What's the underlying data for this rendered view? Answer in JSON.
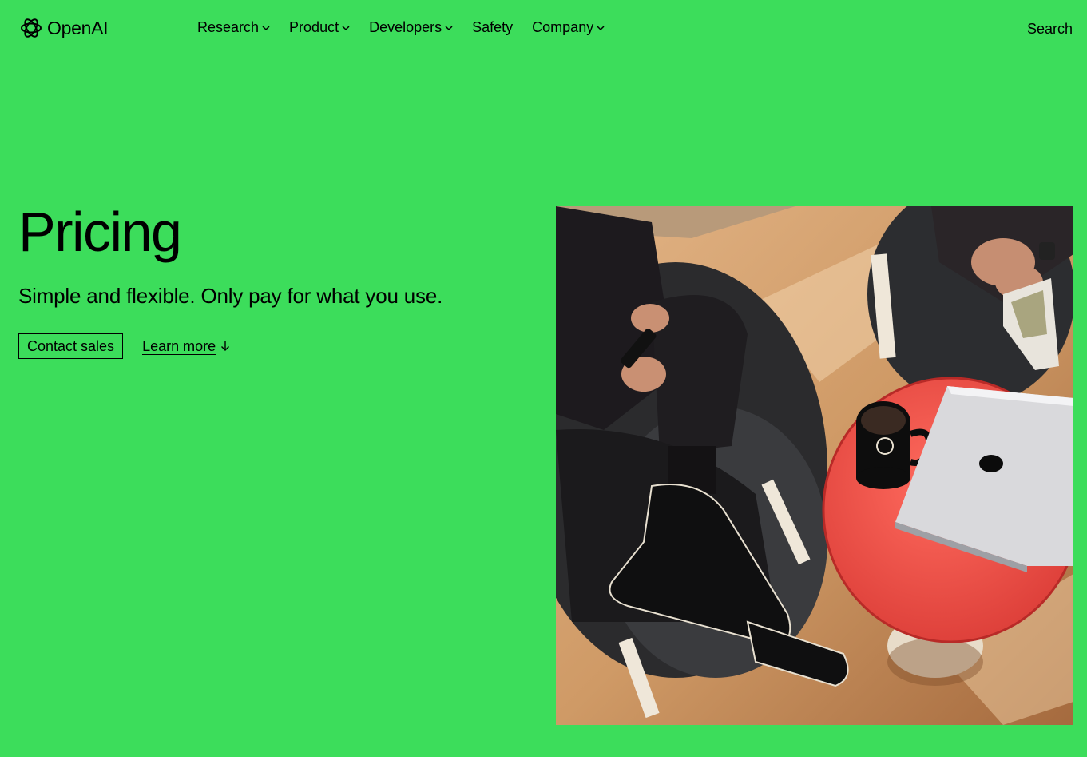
{
  "brand": {
    "name": "OpenAI",
    "icon": "openai-logo-icon"
  },
  "nav": {
    "items": [
      {
        "label": "Research",
        "has_dropdown": true
      },
      {
        "label": "Product",
        "has_dropdown": true
      },
      {
        "label": "Developers",
        "has_dropdown": true
      },
      {
        "label": "Safety",
        "has_dropdown": false
      },
      {
        "label": "Company",
        "has_dropdown": true
      }
    ],
    "search_label": "Search"
  },
  "hero": {
    "title": "Pricing",
    "subtitle": "Simple and flexible. Only pay for what you use.",
    "primary_cta": "Contact sales",
    "secondary_cta": "Learn more",
    "secondary_icon": "arrow-down-icon"
  },
  "colors": {
    "background": "#3cdd5b",
    "text": "#000000"
  },
  "image": {
    "subject": "people-seated-around-red-table-with-laptop-and-mug"
  }
}
